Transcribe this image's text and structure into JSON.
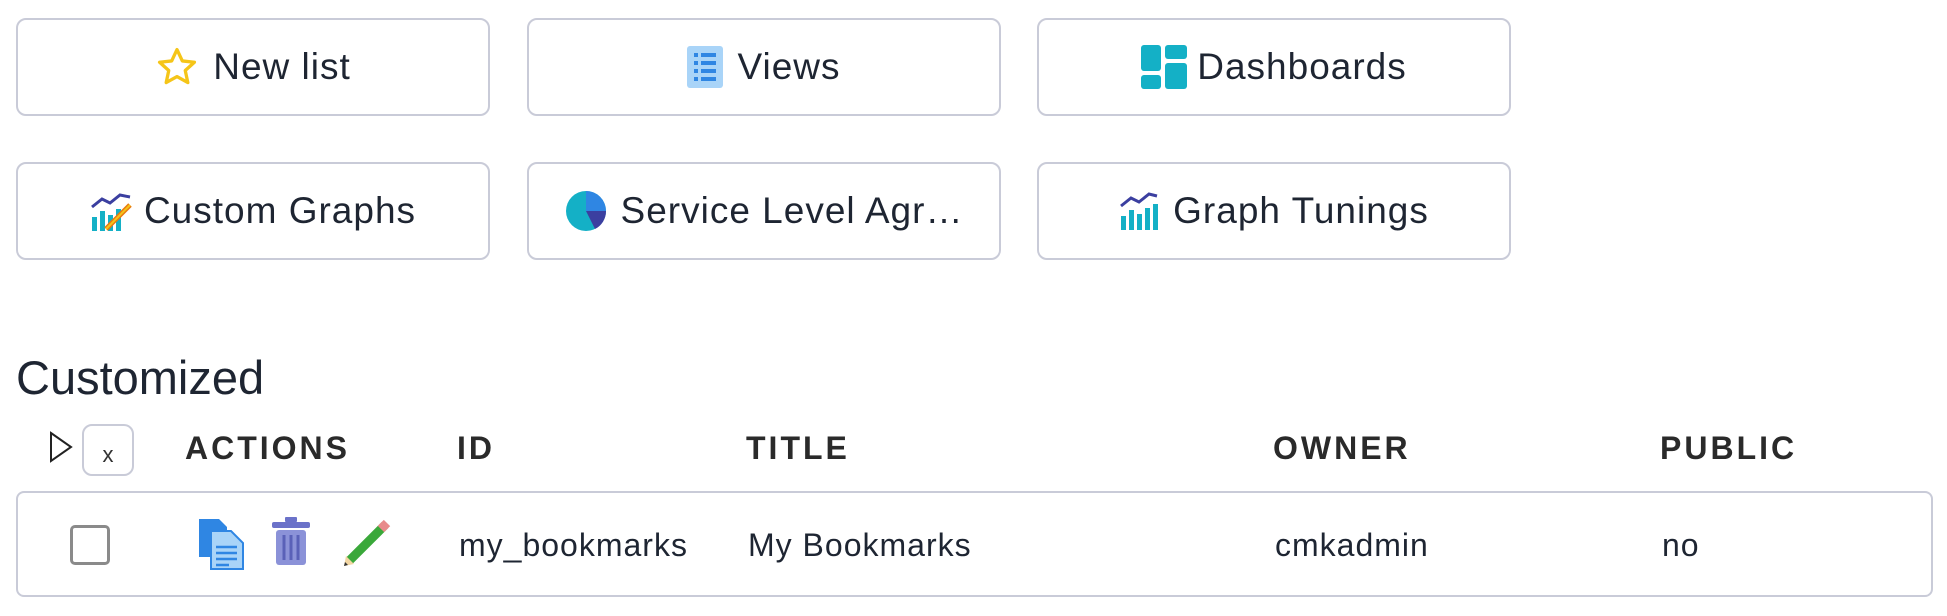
{
  "buttons": [
    {
      "label": "New list",
      "icon": "star-icon"
    },
    {
      "label": "Views",
      "icon": "list-icon"
    },
    {
      "label": "Dashboards",
      "icon": "dashboard-icon"
    },
    {
      "label": "Custom Graphs",
      "icon": "custom-graph-icon"
    },
    {
      "label": "Service Level Agr…",
      "icon": "pie-chart-icon"
    },
    {
      "label": "Graph Tunings",
      "icon": "graph-tuning-icon"
    }
  ],
  "section": {
    "title": "Customized"
  },
  "table": {
    "reset_filter_label": "x",
    "headers": [
      "ACTIONS",
      "ID",
      "TITLE",
      "OWNER",
      "PUBLIC"
    ],
    "rows": [
      {
        "id": "my_bookmarks",
        "title": "My Bookmarks",
        "owner": "cmkadmin",
        "public": "no",
        "actions": [
          "clone-icon",
          "delete-icon",
          "edit-icon"
        ]
      }
    ]
  },
  "colors": {
    "border": "#c9cbd8",
    "teal": "#14b0c6",
    "star": "#f5c518",
    "text": "#1e2532"
  }
}
